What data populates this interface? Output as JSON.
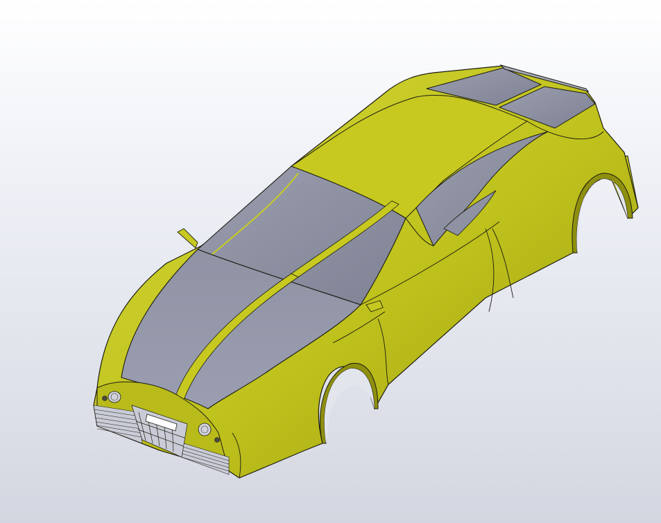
{
  "viewport": {
    "background_top": "#ffffff",
    "background_bottom": "#d3d6e0"
  },
  "model": {
    "body_color": "#c4c61e",
    "body_shadow_color": "#8e8f0e",
    "body_highlight_color": "#d8d93a",
    "glass_color": "#8e92a3",
    "edge_color": "#1a1a10",
    "grille_color": "#c9ccd6"
  }
}
